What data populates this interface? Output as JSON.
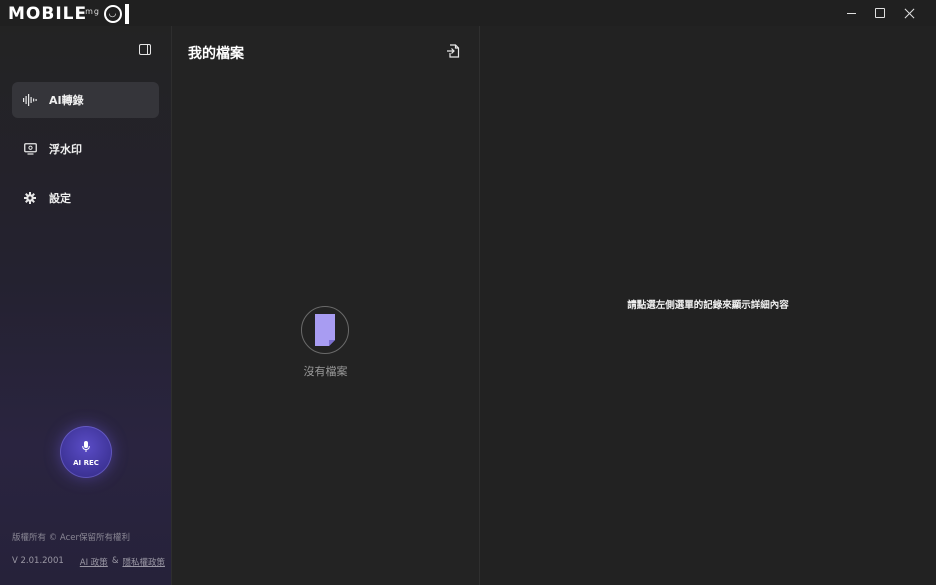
{
  "titlebar": {
    "logo_text": "MOBILE",
    "logo_small": "mg",
    "logo_face": "◡",
    "minimize_icon": "minimize-icon",
    "maximize_icon": "maximize-icon",
    "close_icon": "close-icon"
  },
  "sidebar": {
    "items": [
      {
        "label": "AI轉錄",
        "icon": "waveform-icon",
        "active": true
      },
      {
        "label": "浮水印",
        "icon": "monitor-icon",
        "active": false
      },
      {
        "label": "設定",
        "icon": "gear-icon",
        "active": false
      }
    ],
    "rec_label": "AI REC",
    "copyright": "版權所有 © Acer保留所有權利",
    "version": "V 2.01.2001",
    "ai_policy": "AI 政策",
    "separator": "&",
    "privacy_policy": "隱私權政策"
  },
  "files": {
    "title": "我的檔案",
    "empty_text": "沒有檔案"
  },
  "detail": {
    "hint": "請點選左側選單的記錄來顯示詳細內容"
  },
  "colors": {
    "accent": "#9b8df0",
    "rec_button": "#4a3fb0",
    "background": "#202020"
  }
}
